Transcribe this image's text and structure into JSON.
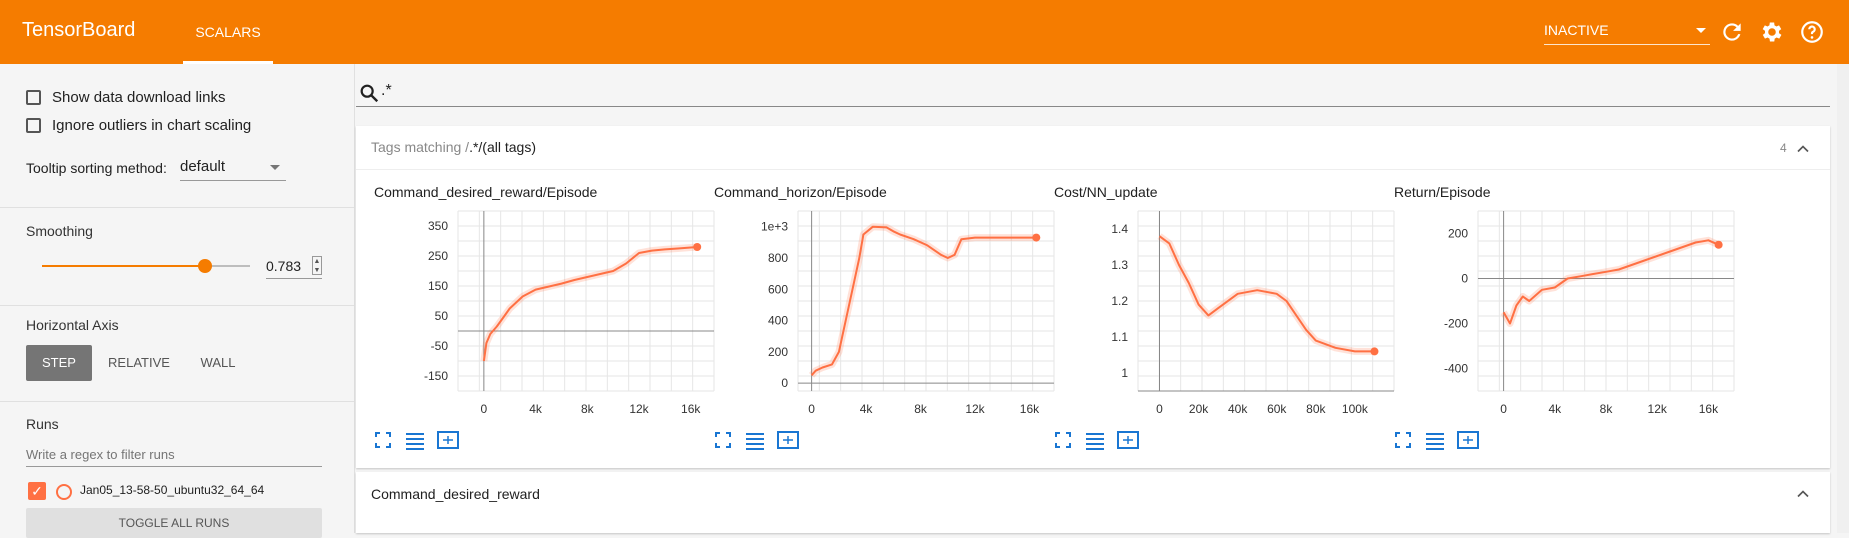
{
  "app": {
    "title": "TensorBoard",
    "active_tab": "SCALARS",
    "status": "INACTIVE",
    "accent": "#f57c00",
    "icons": [
      "refresh-icon",
      "gear-icon",
      "help-icon"
    ]
  },
  "sidebar": {
    "show_download_links": "Show data download links",
    "ignore_outliers": "Ignore outliers in chart scaling",
    "tooltip_label": "Tooltip sorting method:",
    "tooltip_value": "default",
    "smoothing_title": "Smoothing",
    "smoothing_value": "0.783",
    "smoothing_fraction": 0.783,
    "horizontal_axis_title": "Horizontal Axis",
    "axis_options": [
      "STEP",
      "RELATIVE",
      "WALL"
    ],
    "axis_selected": "STEP",
    "runs_title": "Runs",
    "runs_filter_placeholder": "Write a regex to filter runs",
    "run_name": "Jan05_13-58-50_ubuntu32_64_64",
    "run_color": "#ff7043",
    "toggle_all": "TOGGLE ALL RUNS"
  },
  "main": {
    "search_value": ".*",
    "group_prefix": "Tags matching /",
    "group_regex": ".*",
    "group_suffix": "/(all tags)",
    "group_count": "4",
    "second_group_title": "Command_desired_reward"
  },
  "chart_data": [
    {
      "type": "line",
      "title": "Command_desired_reward/Episode",
      "x_ticks": [
        "0",
        "4k",
        "8k",
        "12k",
        "16k"
      ],
      "y_ticks": [
        "350",
        "250",
        "150",
        "50",
        "-50",
        "-150"
      ],
      "xlim": [
        -2000,
        17800
      ],
      "ylim": [
        -200,
        400
      ],
      "series": [
        {
          "smoothed": true,
          "color": "#ff7043",
          "x": [
            0,
            200,
            500,
            1000,
            1500,
            2000,
            3000,
            4000,
            5000,
            6000,
            7000,
            8000,
            9000,
            10000,
            11000,
            12000,
            13000,
            14000,
            15000,
            16500
          ],
          "y": [
            -100,
            -40,
            -10,
            15,
            45,
            75,
            115,
            138,
            148,
            158,
            170,
            180,
            190,
            200,
            225,
            260,
            268,
            272,
            275,
            280
          ]
        }
      ]
    },
    {
      "type": "line",
      "title": "Command_horizon/Episode",
      "x_ticks": [
        "0",
        "4k",
        "8k",
        "12k",
        "16k"
      ],
      "y_ticks": [
        "1e+3",
        "800",
        "600",
        "400",
        "200",
        "0"
      ],
      "xlim": [
        -1000,
        17800
      ],
      "ylim": [
        -50,
        1100
      ],
      "series": [
        {
          "smoothed": true,
          "color": "#ff7043",
          "x": [
            0,
            300,
            800,
            1500,
            2000,
            2500,
            3000,
            3500,
            3800,
            4500,
            5500,
            6000,
            6500,
            7500,
            8500,
            9500,
            10000,
            10500,
            11000,
            12000,
            14000,
            16500
          ],
          "y": [
            50,
            80,
            100,
            120,
            200,
            400,
            600,
            800,
            950,
            1000,
            995,
            970,
            950,
            920,
            880,
            820,
            800,
            820,
            920,
            930,
            930,
            930
          ]
        }
      ]
    },
    {
      "type": "line",
      "title": "Cost/NN_update",
      "x_ticks": [
        "0",
        "20k",
        "40k",
        "60k",
        "80k",
        "100k"
      ],
      "y_ticks": [
        "1.4",
        "1.3",
        "1.2",
        "1.1",
        "1"
      ],
      "xlim": [
        -11000,
        120000
      ],
      "ylim": [
        0.95,
        1.45
      ],
      "series": [
        {
          "smoothed": true,
          "color": "#ff7043",
          "x": [
            0,
            5000,
            10000,
            15000,
            20000,
            25000,
            30000,
            40000,
            50000,
            60000,
            65000,
            70000,
            75000,
            80000,
            90000,
            100000,
            110000
          ],
          "y": [
            1.38,
            1.36,
            1.3,
            1.25,
            1.19,
            1.16,
            1.18,
            1.22,
            1.23,
            1.22,
            1.2,
            1.16,
            1.12,
            1.09,
            1.07,
            1.06,
            1.06
          ]
        }
      ]
    },
    {
      "type": "line",
      "title": "Return/Episode",
      "x_ticks": [
        "0",
        "4k",
        "8k",
        "12k",
        "16k"
      ],
      "y_ticks": [
        "200",
        "0",
        "-200",
        "-400"
      ],
      "xlim": [
        -2000,
        18000
      ],
      "ylim": [
        -500,
        300
      ],
      "series": [
        {
          "smoothed": true,
          "color": "#ff7043",
          "x": [
            0,
            500,
            1000,
            1500,
            2000,
            3000,
            4000,
            5000,
            6000,
            7000,
            8000,
            9000,
            10000,
            11000,
            12000,
            13000,
            14000,
            15000,
            16000,
            16800
          ],
          "y": [
            -150,
            -200,
            -120,
            -80,
            -100,
            -50,
            -40,
            0,
            10,
            20,
            30,
            40,
            60,
            80,
            100,
            120,
            140,
            160,
            170,
            150
          ]
        }
      ]
    }
  ]
}
